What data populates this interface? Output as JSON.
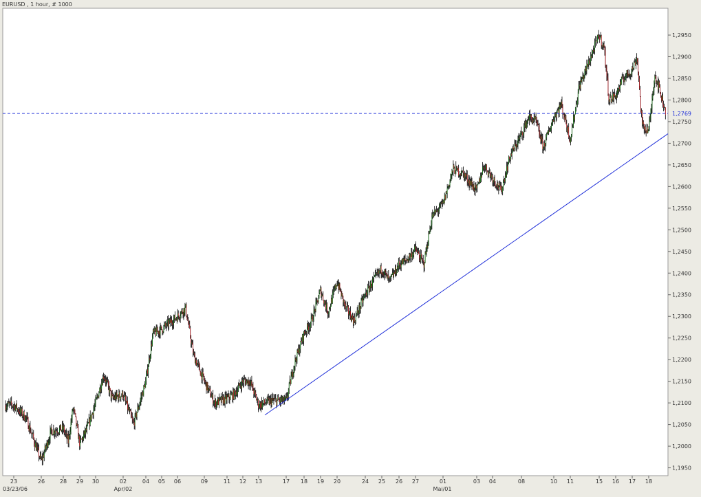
{
  "header": {
    "title": "EURUSD , 1 hour, # 1000"
  },
  "colors": {
    "background": "#ecebe4",
    "plot_bg": "#ffffff",
    "up": "#0a7a0a",
    "down": "#c4161c",
    "wick": "#000000",
    "trendline": "#1f2fd9",
    "price_line": "#1f2fd9",
    "axis_text": "#333333"
  },
  "chart_data": {
    "type": "candlestick",
    "symbol": "EURUSD",
    "timeframe": "1 hour",
    "bar_count": 1000,
    "ylim": [
      1.1935,
      1.2985
    ],
    "grid": false,
    "y_ticks": [
      "1,1950",
      "1,2000",
      "1,2050",
      "1,2100",
      "1,2150",
      "1,2200",
      "1,2250",
      "1,2300",
      "1,2350",
      "1,2400",
      "1,2450",
      "1,2500",
      "1,2550",
      "1,2600",
      "1,2650",
      "1,2700",
      "1,2750",
      "1,2800",
      "1,2850",
      "1,2900",
      "1,2950"
    ],
    "x_day_ticks": [
      "23",
      "26",
      "28",
      "29",
      "30",
      "02",
      "04",
      "05",
      "06",
      "09",
      "11",
      "12",
      "13",
      "17",
      "18",
      "19",
      "20",
      "24",
      "25",
      "26",
      "27",
      "01",
      "03",
      "04",
      "08",
      "10",
      "11",
      "15",
      "16",
      "17",
      "18"
    ],
    "x_month_ticks": [
      "03/23/06",
      "Apr/02",
      "Mai/01"
    ],
    "current_price": {
      "value": 1.2769,
      "label": "1,2769"
    },
    "trendline": {
      "from": {
        "day": "13",
        "price": 1.2072
      },
      "to": {
        "day": "18",
        "price": 1.2722
      }
    },
    "close_path": [
      {
        "day": "23",
        "price": 1.2095
      },
      {
        "day": "23",
        "price": 1.2065
      },
      {
        "day": "26",
        "price": 1.1965
      },
      {
        "day": "26",
        "price": 1.2035
      },
      {
        "day": "28",
        "price": 1.204
      },
      {
        "day": "28",
        "price": 1.201
      },
      {
        "day": "28",
        "price": 1.209
      },
      {
        "day": "29",
        "price": 1.2005
      },
      {
        "day": "29",
        "price": 1.204
      },
      {
        "day": "30",
        "price": 1.21
      },
      {
        "day": "30",
        "price": 1.2165
      },
      {
        "day": "30",
        "price": 1.211
      },
      {
        "day": "02",
        "price": 1.212
      },
      {
        "day": "02",
        "price": 1.205
      },
      {
        "day": "04",
        "price": 1.215
      },
      {
        "day": "04",
        "price": 1.226
      },
      {
        "day": "05",
        "price": 1.227
      },
      {
        "day": "06",
        "price": 1.23
      },
      {
        "day": "06",
        "price": 1.232
      },
      {
        "day": "06",
        "price": 1.221
      },
      {
        "day": "09",
        "price": 1.215
      },
      {
        "day": "09",
        "price": 1.21
      },
      {
        "day": "11",
        "price": 1.211
      },
      {
        "day": "11",
        "price": 1.212
      },
      {
        "day": "12",
        "price": 1.215
      },
      {
        "day": "12",
        "price": 1.215
      },
      {
        "day": "13",
        "price": 1.2095
      },
      {
        "day": "13",
        "price": 1.2105
      },
      {
        "day": "17",
        "price": 1.2105
      },
      {
        "day": "17",
        "price": 1.219
      },
      {
        "day": "18",
        "price": 1.226
      },
      {
        "day": "18",
        "price": 1.229
      },
      {
        "day": "19",
        "price": 1.236
      },
      {
        "day": "19",
        "price": 1.231
      },
      {
        "day": "20",
        "price": 1.238
      },
      {
        "day": "20",
        "price": 1.232
      },
      {
        "day": "20",
        "price": 1.229
      },
      {
        "day": "24",
        "price": 1.235
      },
      {
        "day": "24",
        "price": 1.238
      },
      {
        "day": "25",
        "price": 1.241
      },
      {
        "day": "25",
        "price": 1.238
      },
      {
        "day": "26",
        "price": 1.242
      },
      {
        "day": "26",
        "price": 1.243
      },
      {
        "day": "27",
        "price": 1.2455
      },
      {
        "day": "27",
        "price": 1.242
      },
      {
        "day": "27",
        "price": 1.253
      },
      {
        "day": "01",
        "price": 1.256
      },
      {
        "day": "01",
        "price": 1.264
      },
      {
        "day": "01",
        "price": 1.263
      },
      {
        "day": "03",
        "price": 1.259
      },
      {
        "day": "03",
        "price": 1.265
      },
      {
        "day": "04",
        "price": 1.262
      },
      {
        "day": "04",
        "price": 1.259
      },
      {
        "day": "04",
        "price": 1.267
      },
      {
        "day": "08",
        "price": 1.272
      },
      {
        "day": "08",
        "price": 1.276
      },
      {
        "day": "08",
        "price": 1.275
      },
      {
        "day": "08",
        "price": 1.269
      },
      {
        "day": "10",
        "price": 1.276
      },
      {
        "day": "10",
        "price": 1.279
      },
      {
        "day": "11",
        "price": 1.271
      },
      {
        "day": "11",
        "price": 1.283
      },
      {
        "day": "11",
        "price": 1.288
      },
      {
        "day": "15",
        "price": 1.295
      },
      {
        "day": "15",
        "price": 1.292
      },
      {
        "day": "15",
        "price": 1.28
      },
      {
        "day": "16",
        "price": 1.281
      },
      {
        "day": "16",
        "price": 1.285
      },
      {
        "day": "17",
        "price": 1.287
      },
      {
        "day": "17",
        "price": 1.29
      },
      {
        "day": "17",
        "price": 1.274
      },
      {
        "day": "18",
        "price": 1.273
      },
      {
        "day": "18",
        "price": 1.279
      },
      {
        "day": "18",
        "price": 1.286
      },
      {
        "day": "18",
        "price": 1.284
      },
      {
        "day": "18",
        "price": 1.2769
      }
    ]
  }
}
